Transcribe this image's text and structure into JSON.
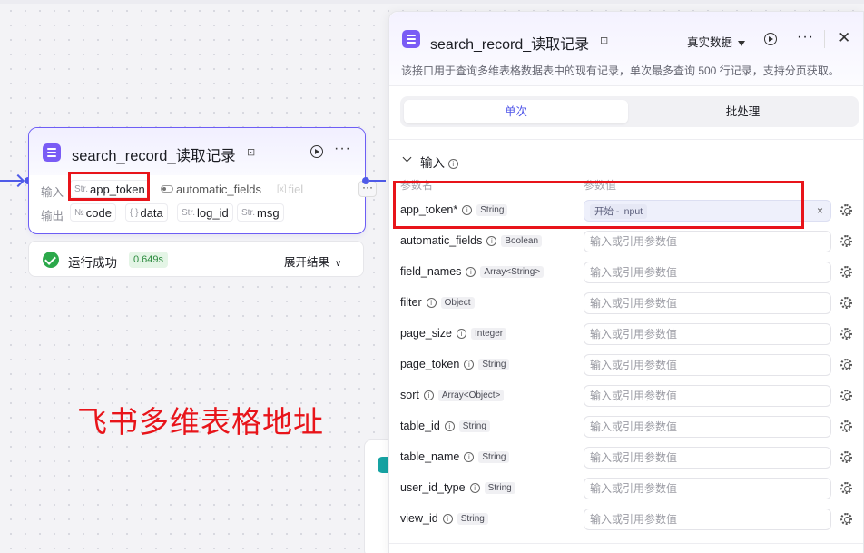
{
  "node": {
    "title": "search_record_读取记录",
    "input_label": "输入",
    "output_label": "输出",
    "inputs": [
      {
        "type": "Str.",
        "name": "app_token"
      },
      {
        "type": "",
        "name": "automatic_fields"
      },
      {
        "type": "[x]",
        "name": "fiel"
      }
    ],
    "outputs": [
      {
        "type": "№",
        "name": "code"
      },
      {
        "type": "{ }",
        "name": "data"
      },
      {
        "type": "Str.",
        "name": "log_id"
      },
      {
        "type": "Str.",
        "name": "msg"
      }
    ],
    "more": "···"
  },
  "status": {
    "text": "运行成功",
    "time": "0.649s",
    "expand": "展开结果"
  },
  "annotation": "飞书多维表格地址",
  "panel": {
    "title": "search_record_读取记录",
    "mode": "真实数据",
    "description": "该接口用于查询多维表格数据表中的现有记录，单次最多查询 500 行记录，支持分页获取。",
    "tabs": [
      "单次",
      "批处理"
    ],
    "section": "输入",
    "col_name": "参数名",
    "col_value": "参数值",
    "placeholder": "输入或引用参数值",
    "params": [
      {
        "name": "app_token*",
        "type": "String",
        "ref": "开始 - input"
      },
      {
        "name": "automatic_fields",
        "type": "Boolean"
      },
      {
        "name": "field_names",
        "type": "Array<String>"
      },
      {
        "name": "filter",
        "type": "Object"
      },
      {
        "name": "page_size",
        "type": "Integer"
      },
      {
        "name": "page_token",
        "type": "String"
      },
      {
        "name": "sort",
        "type": "Array<Object>"
      },
      {
        "name": "table_id",
        "type": "String"
      },
      {
        "name": "table_name",
        "type": "String"
      },
      {
        "name": "user_id_type",
        "type": "String"
      },
      {
        "name": "view_id",
        "type": "String"
      }
    ]
  },
  "colors": {
    "accent": "#4d53e8",
    "node_icon": "#7a5cf5",
    "highlight": "#e8141a",
    "success": "#2ba84a"
  }
}
